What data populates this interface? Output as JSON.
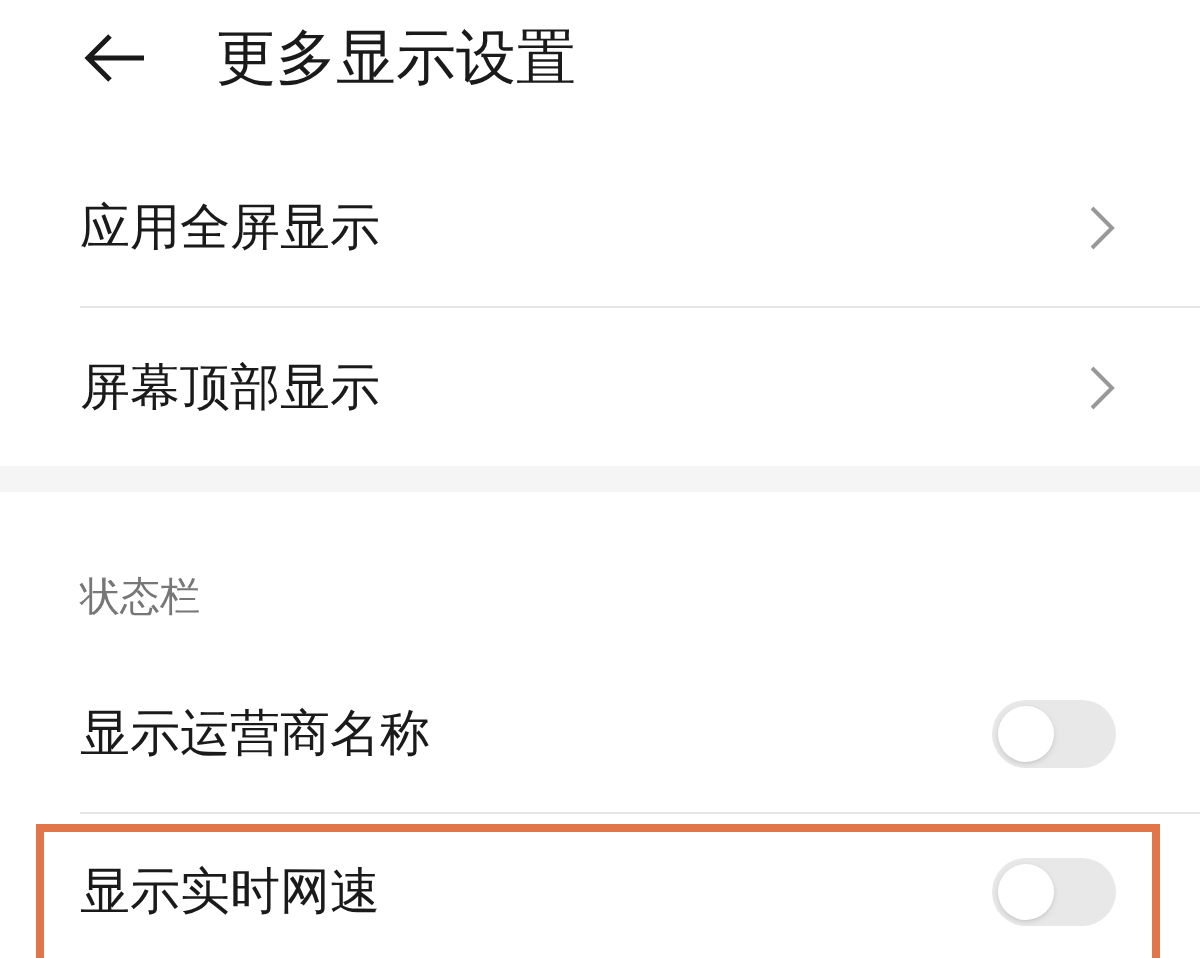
{
  "header": {
    "title": "更多显示设置"
  },
  "groups": [
    {
      "items": [
        {
          "label": "应用全屏显示",
          "kind": "link"
        },
        {
          "label": "屏幕顶部显示",
          "kind": "link"
        }
      ]
    },
    {
      "title": "状态栏",
      "items": [
        {
          "label": "显示运营商名称",
          "kind": "switch",
          "on": false,
          "highlighted": false
        },
        {
          "label": "显示实时网速",
          "kind": "switch",
          "on": false,
          "highlighted": true
        }
      ]
    }
  ]
}
